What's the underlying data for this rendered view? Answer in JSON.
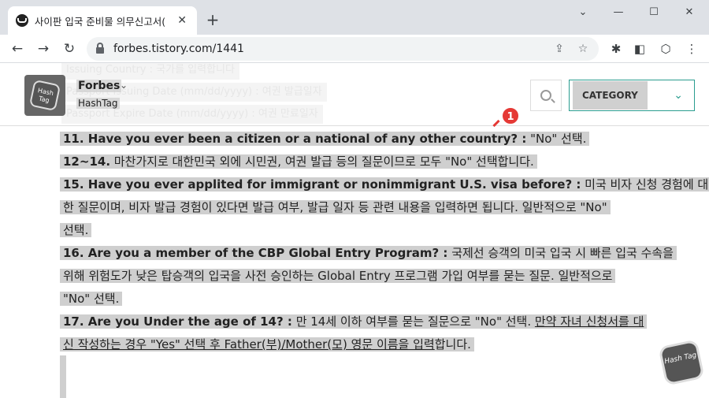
{
  "browser": {
    "tab_title": "사이판 입국 준비물 의무신고서(",
    "url": "forbes.tistory.com/1441"
  },
  "ghost_text": [
    "Issuing Country : 국가를 입력합니다",
    "Passport Issuing Date (mm/dd/yyyy) : 여권 발급일자",
    "Passport Expire Date (mm/dd/yyyy) : 여권 만료일자"
  ],
  "blog": {
    "name": "Forbes",
    "subtitle": "HashTag",
    "category_label": "CATEGORY"
  },
  "annotation_number": "1",
  "lines": [
    {
      "bold": "11. Have you ever been a citizen or a national of any other country? :",
      "rest": " \"No\" 선택."
    },
    {
      "bold": "12~14.",
      "rest": " 마찬가지로 대한민국 외에 시민권, 여권 발급 등의 질문이므로 모두 \"No\" 선택합니다."
    },
    {
      "bold": "15. Have you ever applited for immigrant or nonimmigrant U.S. visa before? :",
      "rest": " 미국 비자 신청 경험에 대"
    },
    {
      "bold": "",
      "rest": "한 질문이며, 비자 발급 경험이 있다면 발급 여부, 발급 일자 등 관련 내용을 입력하면 됩니다. 일반적으로 \"No\""
    },
    {
      "bold": "",
      "rest": "선택."
    },
    {
      "bold": "16. Are you a member of the CBP Global Entry Program? :",
      "rest": " 국제선 승객의 미국 입국 시 빠른 입국 수속을"
    },
    {
      "bold": "",
      "rest": "위해 위험도가 낮은 탑승객의 입국을 사전 승인하는 Global Entry 프로그램 가입 여부를 묻는 질문. 일반적으로"
    },
    {
      "bold": "",
      "rest": "\"No\" 선택."
    },
    {
      "bold": "17. Are you Under the age of 14? :",
      "rest": " 만 14세 이하 여부를 묻는 질문으로 \"No\" 선택. ",
      "underline": "만약 자녀 신청서를 대"
    },
    {
      "bold": "",
      "rest": "",
      "underline": "신 작성하는 경우 \"Yes\" 선택 후 Father(부)/Mother(모) 영문 이름을 입력",
      "tail": "합니다."
    }
  ],
  "hashtag_badge": "Hash Tag"
}
